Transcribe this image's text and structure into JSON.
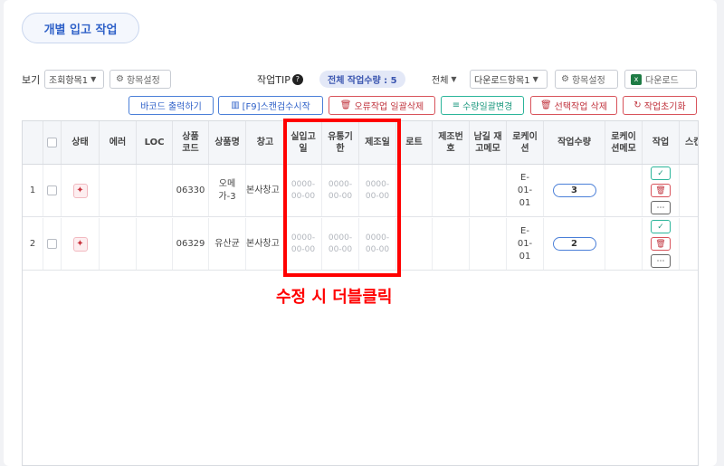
{
  "title": "개별 입고 작업",
  "toolbar": {
    "view_label": "보기",
    "view_select": "조회항목1",
    "item_settings": "항목설정",
    "tip_label": "작업TIP",
    "tip_mark": "?",
    "total_pill": "전체 작업수량 : 5",
    "filter_select": "전체",
    "download_select": "다운로드항목1",
    "item_settings2": "항목설정",
    "download_button": "다운로드",
    "excel_mark": "x"
  },
  "actions": {
    "barcode_print": "바코드 출력하기",
    "scan_start": "[F9]스캔검수시작",
    "bulk_delete_errors": "오류작업 일괄삭제",
    "bulk_qty_change": "수량일괄변경",
    "delete_selected": "선택작업 삭제",
    "reset_work": "작업초기화"
  },
  "table": {
    "headers": {
      "status": "상태",
      "error": "에러",
      "loc": "LOC",
      "product_code": "상품코드",
      "product_name": "상품명",
      "warehouse": "창고",
      "actual_in_date": "실입고일",
      "expiry_date": "유통기한",
      "mfg_date": "제조일",
      "lot": "로트",
      "mfg_no": "제조번호",
      "remaining_memo": "남길 재고메모",
      "location": "로케이션",
      "work_qty": "작업수량",
      "location_memo": "로케이션메모",
      "work": "작업",
      "scan": "스캔"
    },
    "rows": [
      {
        "no": "1",
        "product_code": "06330",
        "product_name": "오메가-3",
        "warehouse": "본사창고",
        "actual_in_date": "0000-00-00",
        "expiry_date": "0000-00-00",
        "mfg_date": "0000-00-00",
        "location": "E-01-01",
        "work_qty": "3"
      },
      {
        "no": "2",
        "product_code": "06329",
        "product_name": "유산균",
        "warehouse": "본사창고",
        "actual_in_date": "0000-00-00",
        "expiry_date": "0000-00-00",
        "mfg_date": "0000-00-00",
        "location": "E-01-01",
        "work_qty": "2"
      }
    ]
  },
  "annotation": "수정 시 더블클릭",
  "colors": {
    "accent": "#2f61c8",
    "annotation": "#ff0000",
    "danger": "#c0333d",
    "teal": "#1e9a80"
  },
  "icons": [
    "gear-icon",
    "question-icon",
    "excel-icon",
    "barcode-icon",
    "trash-icon",
    "sliders-icon",
    "refresh-icon",
    "check-icon",
    "more-icon",
    "status-icon"
  ]
}
